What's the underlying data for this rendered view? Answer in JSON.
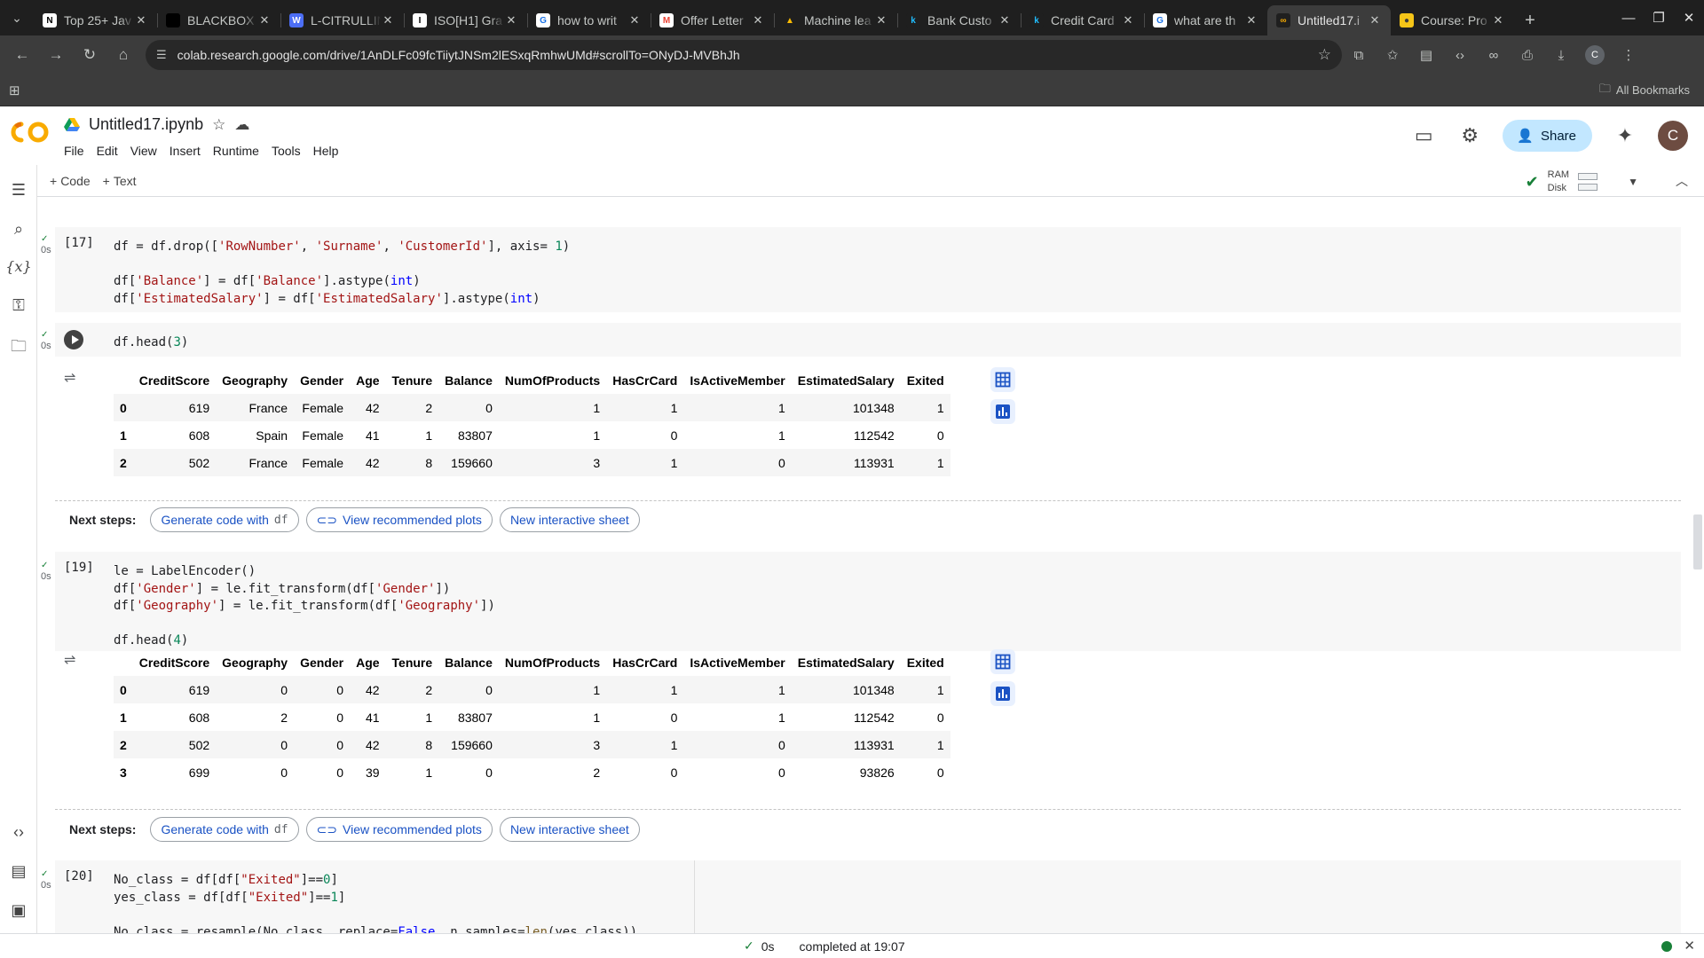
{
  "browser": {
    "tabs": [
      {
        "title": "Top 25+ Jav",
        "fav": "N",
        "fav_color": "#ffffff",
        "fav_text": "#000000"
      },
      {
        "title": "BLACKBOX",
        "fav": "",
        "fav_color": "#000000",
        "fav_text": "#ffffff"
      },
      {
        "title": "L-CITRULLIN",
        "fav": "W",
        "fav_color": "#4c6ef5",
        "fav_text": "#ffffff"
      },
      {
        "title": "ISO[H1] Gra",
        "fav": "I",
        "fav_color": "#ffffff",
        "fav_text": "#000000"
      },
      {
        "title": "how to writ",
        "fav": "G",
        "fav_color": "#ffffff",
        "fav_text": "#1a73e8"
      },
      {
        "title": "Offer Letter",
        "fav": "M",
        "fav_color": "#ffffff",
        "fav_text": "#ea4335"
      },
      {
        "title": "Machine lea",
        "fav": "▲",
        "fav_color": "#1f1f1f",
        "fav_text": "#fbbc04"
      },
      {
        "title": "Bank Custo",
        "fav": "k",
        "fav_color": "#1f1f1f",
        "fav_text": "#20beff"
      },
      {
        "title": "Credit Card",
        "fav": "k",
        "fav_color": "#1f1f1f",
        "fav_text": "#20beff"
      },
      {
        "title": "what are th",
        "fav": "G",
        "fav_color": "#ffffff",
        "fav_text": "#1a73e8"
      },
      {
        "title": "Untitled17.i",
        "fav": "∞",
        "fav_color": "#1f1f1f",
        "fav_text": "#f9ab00",
        "active": true
      },
      {
        "title": "Course: Pro",
        "fav": "●",
        "fav_color": "#f5c518",
        "fav_text": "#3c3c3c"
      }
    ],
    "url": "colab.research.google.com/drive/1AnDLFc09fcTiiytJNSm2lESxqRmhwUMd#scrollTo=ONyDJ-MVBhJh",
    "all_bookmarks": "All Bookmarks",
    "avatar_letter": "C"
  },
  "colab": {
    "logo": "CO",
    "notebook_title": "Untitled17.ipynb",
    "menu": [
      "File",
      "Edit",
      "View",
      "Insert",
      "Runtime",
      "Tools",
      "Help"
    ],
    "share_label": "Share",
    "user_initial": "C",
    "toolbar": {
      "code_label": "Code",
      "text_label": "Text",
      "ram_label": "RAM",
      "disk_label": "Disk"
    }
  },
  "cells": {
    "c17": {
      "exec": "[17]",
      "time": "0s",
      "lines": [
        [
          {
            "t": "df = df.drop(["
          },
          {
            "t": "'RowNumber'",
            "c": "s"
          },
          {
            "t": ", "
          },
          {
            "t": "'Surname'",
            "c": "s"
          },
          {
            "t": ", "
          },
          {
            "t": "'CustomerId'",
            "c": "s"
          },
          {
            "t": "], axis= "
          },
          {
            "t": "1",
            "c": "n"
          },
          {
            "t": ")"
          }
        ],
        [],
        [
          {
            "t": "df["
          },
          {
            "t": "'Balance'",
            "c": "s"
          },
          {
            "t": "] = df["
          },
          {
            "t": "'Balance'",
            "c": "s"
          },
          {
            "t": "].astype("
          },
          {
            "t": "int",
            "c": "k"
          },
          {
            "t": ")"
          }
        ],
        [
          {
            "t": "df["
          },
          {
            "t": "'EstimatedSalary'",
            "c": "s"
          },
          {
            "t": "] = df["
          },
          {
            "t": "'EstimatedSalary'",
            "c": "s"
          },
          {
            "t": "].astype("
          },
          {
            "t": "int",
            "c": "k"
          },
          {
            "t": ")"
          }
        ]
      ]
    },
    "c18": {
      "time": "0s",
      "lines": [
        [
          {
            "t": "df.head("
          },
          {
            "t": "3",
            "c": "n"
          },
          {
            "t": ")"
          }
        ]
      ]
    },
    "c19": {
      "exec": "[19]",
      "time": "0s",
      "lines": [
        [
          {
            "t": "le = LabelEncoder()"
          }
        ],
        [
          {
            "t": "df["
          },
          {
            "t": "'Gender'",
            "c": "s"
          },
          {
            "t": "] = le.fit_transform(df["
          },
          {
            "t": "'Gender'",
            "c": "s"
          },
          {
            "t": "])"
          }
        ],
        [
          {
            "t": "df["
          },
          {
            "t": "'Geography'",
            "c": "s"
          },
          {
            "t": "] = le.fit_transform(df["
          },
          {
            "t": "'Geography'",
            "c": "s"
          },
          {
            "t": "])"
          }
        ],
        [],
        [
          {
            "t": "df.head("
          },
          {
            "t": "4",
            "c": "n"
          },
          {
            "t": ")"
          }
        ]
      ]
    },
    "c20": {
      "exec": "[20]",
      "time": "0s",
      "lines": [
        [
          {
            "t": "No_class = df[df["
          },
          {
            "t": "\"Exited\"",
            "c": "s"
          },
          {
            "t": "]=="
          },
          {
            "t": "0",
            "c": "n"
          },
          {
            "t": "]"
          }
        ],
        [
          {
            "t": "yes_class = df[df["
          },
          {
            "t": "\"Exited\"",
            "c": "s"
          },
          {
            "t": "]=="
          },
          {
            "t": "1",
            "c": "n"
          },
          {
            "t": "]"
          }
        ],
        [],
        [
          {
            "t": "No_class = resample(No_class, replace="
          },
          {
            "t": "False",
            "c": "k"
          },
          {
            "t": ", n_samples="
          },
          {
            "t": "len",
            "c": "b"
          },
          {
            "t": "(yes_class))"
          }
        ]
      ]
    }
  },
  "tables": {
    "columns": [
      "",
      "CreditScore",
      "Geography",
      "Gender",
      "Age",
      "Tenure",
      "Balance",
      "NumOfProducts",
      "HasCrCard",
      "IsActiveMember",
      "EstimatedSalary",
      "Exited"
    ],
    "t1": [
      [
        "0",
        "619",
        "France",
        "Female",
        "42",
        "2",
        "0",
        "1",
        "1",
        "1",
        "101348",
        "1"
      ],
      [
        "1",
        "608",
        "Spain",
        "Female",
        "41",
        "1",
        "83807",
        "1",
        "0",
        "1",
        "112542",
        "0"
      ],
      [
        "2",
        "502",
        "France",
        "Female",
        "42",
        "8",
        "159660",
        "3",
        "1",
        "0",
        "113931",
        "1"
      ]
    ],
    "t2": [
      [
        "0",
        "619",
        "0",
        "0",
        "42",
        "2",
        "0",
        "1",
        "1",
        "1",
        "101348",
        "1"
      ],
      [
        "1",
        "608",
        "2",
        "0",
        "41",
        "1",
        "83807",
        "1",
        "0",
        "1",
        "112542",
        "0"
      ],
      [
        "2",
        "502",
        "0",
        "0",
        "42",
        "8",
        "159660",
        "3",
        "1",
        "0",
        "113931",
        "1"
      ],
      [
        "3",
        "699",
        "0",
        "0",
        "39",
        "1",
        "0",
        "2",
        "0",
        "0",
        "93826",
        "0"
      ]
    ]
  },
  "next_steps": {
    "label": "Next steps:",
    "generate_label": "Generate code with",
    "df_var": "df",
    "plots_label": "View recommended plots",
    "sheet_label": "New interactive sheet"
  },
  "status": {
    "elapsed": "0s",
    "completed": "completed at 19:07"
  },
  "colors": {
    "accent_blue": "#1a52c4",
    "share_bg": "#c2e7ff",
    "success_green": "#188038"
  }
}
